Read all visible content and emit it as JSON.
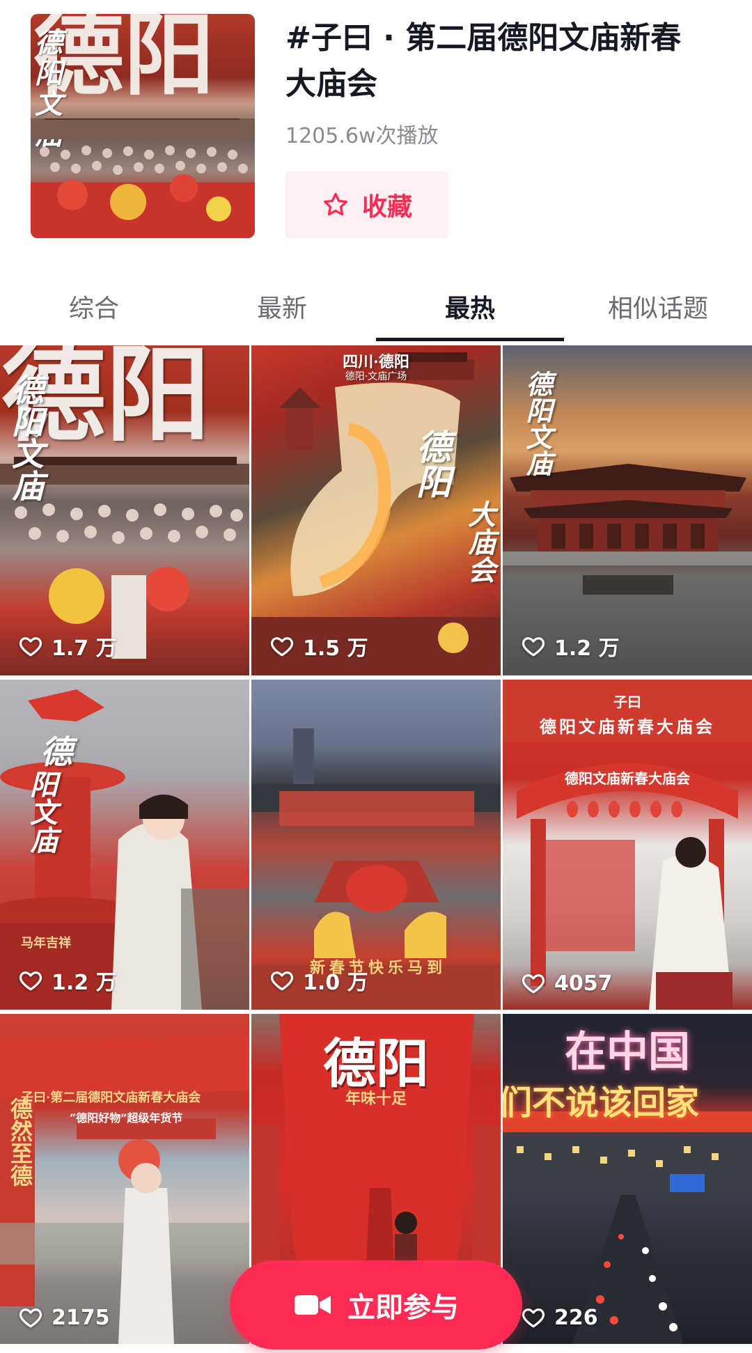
{
  "topic": {
    "title": "#子曰 · 第二届德阳文庙新春大庙会",
    "plays": "1205.6w次播放",
    "favorite_label": "收藏",
    "cover_big_text": "德阳",
    "cover_side_text": "德阳文庙"
  },
  "tabs": [
    {
      "label": "综合",
      "active": false
    },
    {
      "label": "最新",
      "active": false
    },
    {
      "label": "最热",
      "active": true
    },
    {
      "label": "相似话题",
      "active": false
    }
  ],
  "videos": [
    {
      "likes": "1.7 万",
      "overlay_big": "德阳",
      "overlay_side": "德阳文庙"
    },
    {
      "likes": "1.5 万",
      "overlay_top": "四川·德阳",
      "overlay_sub": "德阳·文庙广场",
      "overlay_a": "德阳",
      "overlay_b": "大庙会"
    },
    {
      "likes": "1.2 万",
      "overlay_side": "德阳文庙"
    },
    {
      "likes": "1.2 万",
      "overlay_side_a": "德",
      "overlay_side_b": "阳文庙",
      "overlay_banner": "马年吉祥"
    },
    {
      "likes": "1.0 万",
      "overlay_bottom": "新春节快乐马到"
    },
    {
      "likes": "4057",
      "overlay_top": "子曰",
      "overlay_row": "德阳文庙新春大庙会",
      "overlay_arch": "德阳文庙新春大庙会"
    },
    {
      "likes": "2175",
      "overlay_banner": "子曰·第二届德阳文庙新春大庙会",
      "overlay_sub": "“德阳好物”超级年货节",
      "overlay_side": "德然至德"
    },
    {
      "likes": "",
      "overlay_big": "德阳",
      "overlay_sub": "年味十足"
    },
    {
      "likes": "226",
      "overlay_top": "在中国",
      "overlay_sub": "们不说该回家"
    }
  ],
  "join_button_label": "立即参与",
  "colors": {
    "accent": "#fe2c55",
    "accent_bg": "#fff0f3",
    "text_primary": "#161823",
    "text_secondary": "#8a8b91"
  }
}
